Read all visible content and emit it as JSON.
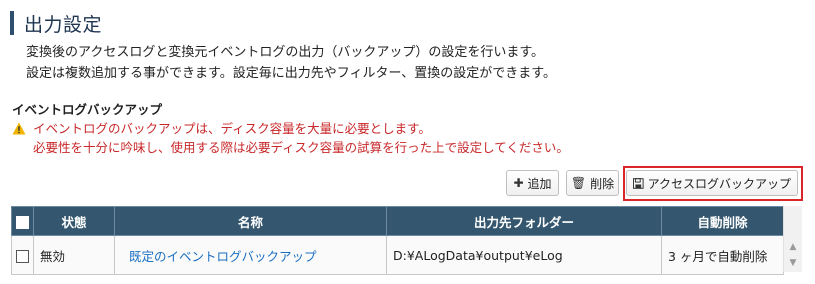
{
  "page": {
    "title": "出力設定",
    "description_lines": [
      "変換後のアクセスログと変換元イベントログの出力（バックアップ）の設定を行います。",
      "設定は複数追加する事ができます。設定毎に出力先やフィルター、置換の設定ができます。"
    ]
  },
  "section": {
    "title": "イベントログバックアップ",
    "warning_lines": [
      "イベントログのバックアップは、ディスク容量を大量に必要とします。",
      "必要性を十分に吟味し、使用する際は必要ディスク容量の試算を行った上で設定してください。"
    ]
  },
  "toolbar": {
    "add_label": "追加",
    "delete_label": "削除",
    "access_log_backup_label": "アクセスログバックアップ"
  },
  "table": {
    "headers": [
      "状態",
      "名称",
      "出力先フォルダー",
      "自動削除"
    ],
    "rows": [
      {
        "status": "無効",
        "name": "既定のイベントログバックアップ",
        "folder": "D:¥ALogData¥output¥eLog",
        "auto_delete": "3 ヶ月で自動削除"
      }
    ]
  },
  "colors": {
    "header_bg": "#34576f",
    "warning": "#c8282a",
    "link": "#1a6fc2",
    "highlight": "#d9262a"
  },
  "icons": [
    "warning-icon",
    "plus-icon",
    "trash-icon",
    "save-icon",
    "scroll-up-icon",
    "scroll-down-icon"
  ]
}
